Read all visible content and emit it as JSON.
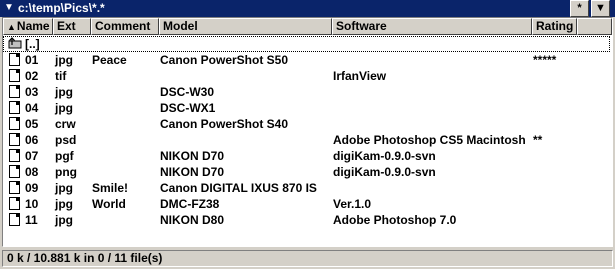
{
  "titlebar": {
    "path": "c:\\temp\\Pics\\*.*",
    "star_label": "*",
    "dropdown_label": "▼"
  },
  "columns": [
    {
      "label": "Name",
      "sorted": true
    },
    {
      "label": "Ext"
    },
    {
      "label": "Comment"
    },
    {
      "label": "Model"
    },
    {
      "label": "Software"
    },
    {
      "label": "Rating"
    }
  ],
  "parent_row": {
    "name": "[..]"
  },
  "files": [
    {
      "name": "01",
      "ext": "jpg",
      "comment": "Peace",
      "model": "Canon PowerShot S50",
      "software": "",
      "rating": "*****"
    },
    {
      "name": "02",
      "ext": "tif",
      "comment": "",
      "model": "",
      "software": "IrfanView",
      "rating": ""
    },
    {
      "name": "03",
      "ext": "jpg",
      "comment": "",
      "model": "DSC-W30",
      "software": "",
      "rating": ""
    },
    {
      "name": "04",
      "ext": "jpg",
      "comment": "",
      "model": "DSC-WX1",
      "software": "",
      "rating": ""
    },
    {
      "name": "05",
      "ext": "crw",
      "comment": "",
      "model": "Canon PowerShot S40",
      "software": "",
      "rating": ""
    },
    {
      "name": "06",
      "ext": "psd",
      "comment": "",
      "model": "",
      "software": "Adobe Photoshop CS5 Macintosh",
      "rating": "**"
    },
    {
      "name": "07",
      "ext": "pgf",
      "comment": "",
      "model": "NIKON D70",
      "software": "digiKam-0.9.0-svn",
      "rating": ""
    },
    {
      "name": "08",
      "ext": "png",
      "comment": "",
      "model": "NIKON D70",
      "software": "digiKam-0.9.0-svn",
      "rating": ""
    },
    {
      "name": "09",
      "ext": "jpg",
      "comment": "Smile!",
      "model": "Canon DIGITAL IXUS 870 IS",
      "software": "",
      "rating": ""
    },
    {
      "name": "10",
      "ext": "jpg",
      "comment": "World",
      "model": "DMC-FZ38",
      "software": "Ver.1.0",
      "rating": ""
    },
    {
      "name": "11",
      "ext": "jpg",
      "comment": "",
      "model": "NIKON D80",
      "software": "Adobe Photoshop 7.0",
      "rating": ""
    }
  ],
  "status": {
    "text": "0 k / 10.881 k in 0 / 11 file(s)"
  },
  "icons": {
    "sort": "sort-up-arrow-icon",
    "file": "file-icon",
    "parent": "parent-folder-icon"
  }
}
